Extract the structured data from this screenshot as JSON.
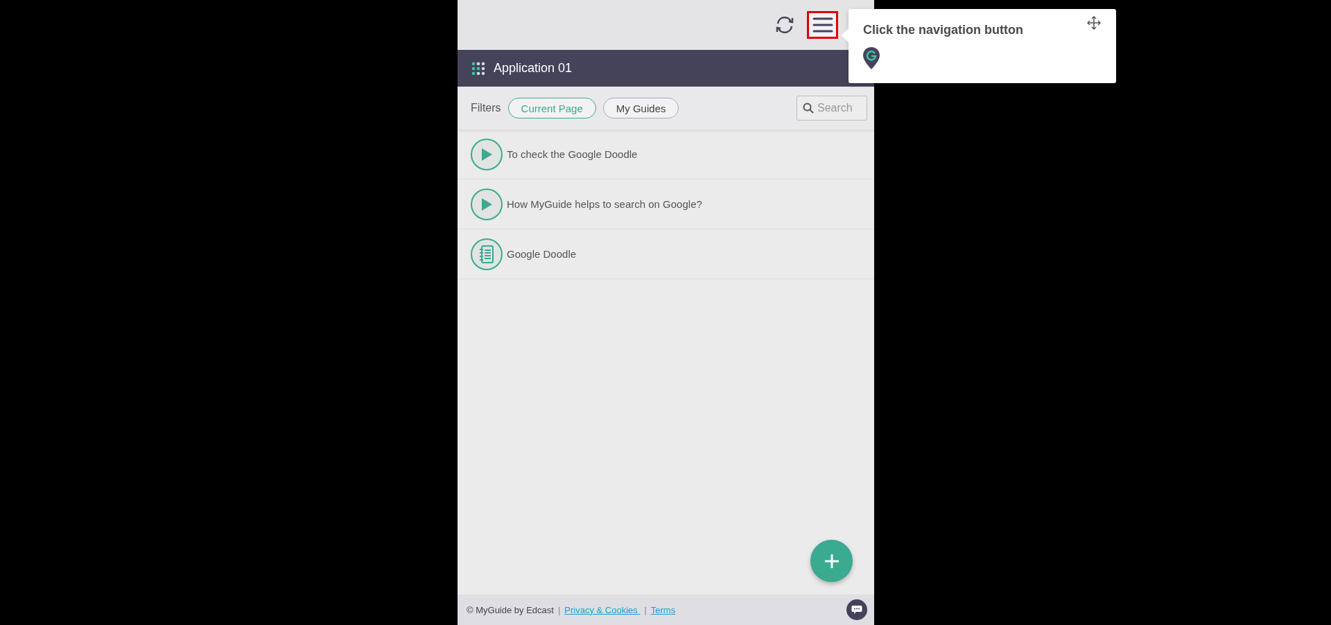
{
  "toolbar": {
    "menu_highlighted": true
  },
  "header": {
    "title": "Application 01"
  },
  "filters": {
    "label": "Filters",
    "options": [
      {
        "label": "Current Page",
        "selected": true
      },
      {
        "label": "My Guides",
        "selected": false
      }
    ],
    "search": {
      "placeholder": "Search"
    }
  },
  "guides": [
    {
      "kind": "video",
      "title": "To check the Google Doodle"
    },
    {
      "kind": "video",
      "title": "How MyGuide helps to search on Google?"
    },
    {
      "kind": "document",
      "title": "Google Doodle"
    }
  ],
  "footer": {
    "copyright": "© MyGuide by Edcast",
    "separator_1": "|",
    "privacy": "Privacy & Cookies ",
    "separator_2": "|",
    "terms": "Terms"
  },
  "tooltip": {
    "text": "Click the navigation button"
  }
}
